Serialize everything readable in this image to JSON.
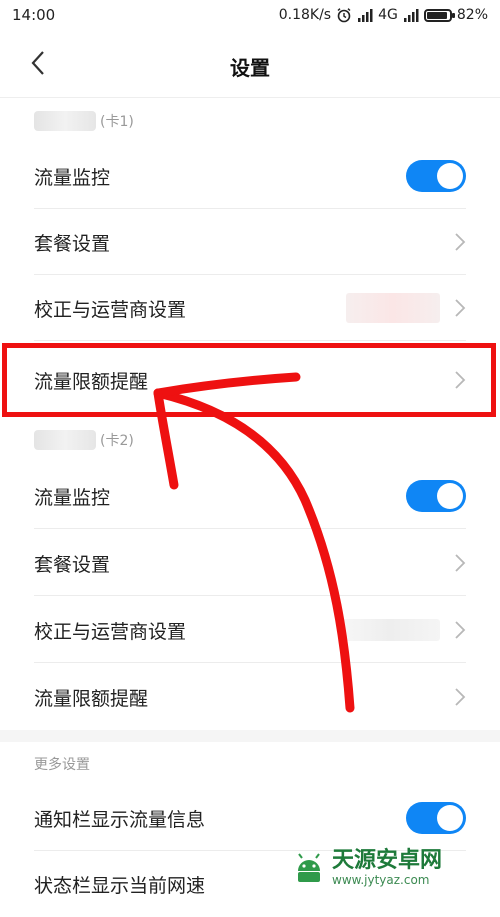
{
  "status_bar": {
    "time": "14:00",
    "speed": "0.18K/s",
    "network": "4G",
    "battery": "82%",
    "battery_level": 0.82
  },
  "header": {
    "title": "设置"
  },
  "sim1": {
    "header_label": "(卡1)",
    "items": [
      {
        "label": "流量监控"
      },
      {
        "label": "套餐设置"
      },
      {
        "label": "校正与运营商设置"
      },
      {
        "label": "流量限额提醒"
      }
    ]
  },
  "sim2": {
    "header_label": "(卡2)",
    "items": [
      {
        "label": "流量监控"
      },
      {
        "label": "套餐设置"
      },
      {
        "label": "校正与运营商设置"
      },
      {
        "label": "流量限额提醒"
      }
    ]
  },
  "more": {
    "header_label": "更多设置",
    "items": [
      {
        "label": "通知栏显示流量信息"
      },
      {
        "label": "状态栏显示当前网速"
      }
    ]
  },
  "annotation": {
    "color": "#ee1111"
  },
  "accent": "#0f86f5",
  "watermark": {
    "name": "天源安卓网",
    "url": "www.jytyaz.com"
  },
  "icons": [
    "alarm-icon",
    "signal-icon",
    "battery-icon",
    "back-arrow-icon",
    "chevron-right-icon",
    "toggle-switch"
  ]
}
